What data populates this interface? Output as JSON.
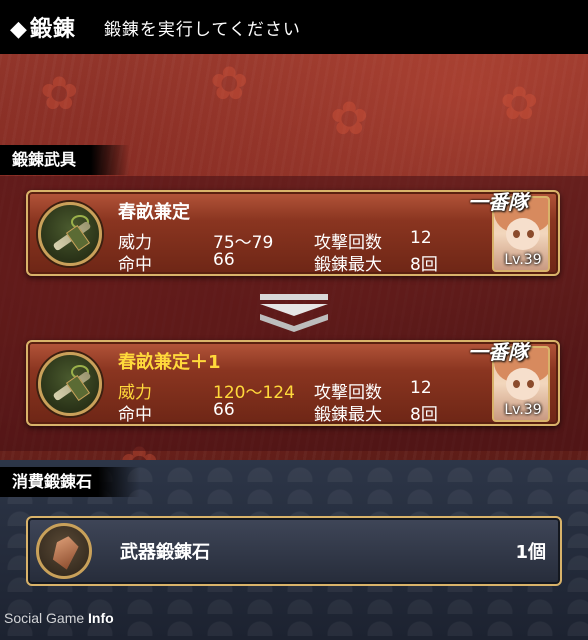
{
  "header": {
    "title": "鍛錬",
    "instruction": "鍛錬を実行してください"
  },
  "sections": {
    "weapon_label": "鍛錬武具",
    "material_label": "消費鍛錬石"
  },
  "current_weapon": {
    "name": "春畝兼定",
    "stats": {
      "power_label": "威力",
      "power_value": "75～79",
      "hits_label": "攻撃回数",
      "hits_value": "12",
      "accuracy_label": "命中",
      "accuracy_value": "66",
      "max_forge_label": "鍛錬最大",
      "max_forge_value": "8回"
    },
    "level_badge": "Lv.39",
    "badge_script": "一番隊"
  },
  "forged_weapon": {
    "name": "春畝兼定＋1",
    "stats": {
      "power_label": "威力",
      "power_value": "120～124",
      "hits_label": "攻撃回数",
      "hits_value": "12",
      "accuracy_label": "命中",
      "accuracy_value": "66",
      "max_forge_label": "鍛錬最大",
      "max_forge_value": "8回"
    },
    "level_badge": "Lv.39",
    "badge_script": "一番隊"
  },
  "material": {
    "name": "武器鍛錬石",
    "count": "1個"
  },
  "watermark": {
    "part1": "Social Game ",
    "part2": "Info"
  },
  "colors": {
    "accent_gold": "#d9b36a",
    "highlight_yellow": "#ffd93b"
  }
}
